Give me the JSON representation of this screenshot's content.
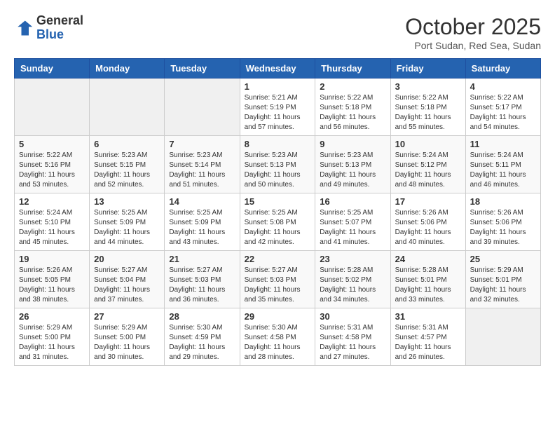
{
  "header": {
    "logo_general": "General",
    "logo_blue": "Blue",
    "month_title": "October 2025",
    "subtitle": "Port Sudan, Red Sea, Sudan"
  },
  "weekdays": [
    "Sunday",
    "Monday",
    "Tuesday",
    "Wednesday",
    "Thursday",
    "Friday",
    "Saturday"
  ],
  "weeks": [
    [
      {
        "day": "",
        "info": ""
      },
      {
        "day": "",
        "info": ""
      },
      {
        "day": "",
        "info": ""
      },
      {
        "day": "1",
        "info": "Sunrise: 5:21 AM\nSunset: 5:19 PM\nDaylight: 11 hours and 57 minutes."
      },
      {
        "day": "2",
        "info": "Sunrise: 5:22 AM\nSunset: 5:18 PM\nDaylight: 11 hours and 56 minutes."
      },
      {
        "day": "3",
        "info": "Sunrise: 5:22 AM\nSunset: 5:18 PM\nDaylight: 11 hours and 55 minutes."
      },
      {
        "day": "4",
        "info": "Sunrise: 5:22 AM\nSunset: 5:17 PM\nDaylight: 11 hours and 54 minutes."
      }
    ],
    [
      {
        "day": "5",
        "info": "Sunrise: 5:22 AM\nSunset: 5:16 PM\nDaylight: 11 hours and 53 minutes."
      },
      {
        "day": "6",
        "info": "Sunrise: 5:23 AM\nSunset: 5:15 PM\nDaylight: 11 hours and 52 minutes."
      },
      {
        "day": "7",
        "info": "Sunrise: 5:23 AM\nSunset: 5:14 PM\nDaylight: 11 hours and 51 minutes."
      },
      {
        "day": "8",
        "info": "Sunrise: 5:23 AM\nSunset: 5:13 PM\nDaylight: 11 hours and 50 minutes."
      },
      {
        "day": "9",
        "info": "Sunrise: 5:23 AM\nSunset: 5:13 PM\nDaylight: 11 hours and 49 minutes."
      },
      {
        "day": "10",
        "info": "Sunrise: 5:24 AM\nSunset: 5:12 PM\nDaylight: 11 hours and 48 minutes."
      },
      {
        "day": "11",
        "info": "Sunrise: 5:24 AM\nSunset: 5:11 PM\nDaylight: 11 hours and 46 minutes."
      }
    ],
    [
      {
        "day": "12",
        "info": "Sunrise: 5:24 AM\nSunset: 5:10 PM\nDaylight: 11 hours and 45 minutes."
      },
      {
        "day": "13",
        "info": "Sunrise: 5:25 AM\nSunset: 5:09 PM\nDaylight: 11 hours and 44 minutes."
      },
      {
        "day": "14",
        "info": "Sunrise: 5:25 AM\nSunset: 5:09 PM\nDaylight: 11 hours and 43 minutes."
      },
      {
        "day": "15",
        "info": "Sunrise: 5:25 AM\nSunset: 5:08 PM\nDaylight: 11 hours and 42 minutes."
      },
      {
        "day": "16",
        "info": "Sunrise: 5:25 AM\nSunset: 5:07 PM\nDaylight: 11 hours and 41 minutes."
      },
      {
        "day": "17",
        "info": "Sunrise: 5:26 AM\nSunset: 5:06 PM\nDaylight: 11 hours and 40 minutes."
      },
      {
        "day": "18",
        "info": "Sunrise: 5:26 AM\nSunset: 5:06 PM\nDaylight: 11 hours and 39 minutes."
      }
    ],
    [
      {
        "day": "19",
        "info": "Sunrise: 5:26 AM\nSunset: 5:05 PM\nDaylight: 11 hours and 38 minutes."
      },
      {
        "day": "20",
        "info": "Sunrise: 5:27 AM\nSunset: 5:04 PM\nDaylight: 11 hours and 37 minutes."
      },
      {
        "day": "21",
        "info": "Sunrise: 5:27 AM\nSunset: 5:03 PM\nDaylight: 11 hours and 36 minutes."
      },
      {
        "day": "22",
        "info": "Sunrise: 5:27 AM\nSunset: 5:03 PM\nDaylight: 11 hours and 35 minutes."
      },
      {
        "day": "23",
        "info": "Sunrise: 5:28 AM\nSunset: 5:02 PM\nDaylight: 11 hours and 34 minutes."
      },
      {
        "day": "24",
        "info": "Sunrise: 5:28 AM\nSunset: 5:01 PM\nDaylight: 11 hours and 33 minutes."
      },
      {
        "day": "25",
        "info": "Sunrise: 5:29 AM\nSunset: 5:01 PM\nDaylight: 11 hours and 32 minutes."
      }
    ],
    [
      {
        "day": "26",
        "info": "Sunrise: 5:29 AM\nSunset: 5:00 PM\nDaylight: 11 hours and 31 minutes."
      },
      {
        "day": "27",
        "info": "Sunrise: 5:29 AM\nSunset: 5:00 PM\nDaylight: 11 hours and 30 minutes."
      },
      {
        "day": "28",
        "info": "Sunrise: 5:30 AM\nSunset: 4:59 PM\nDaylight: 11 hours and 29 minutes."
      },
      {
        "day": "29",
        "info": "Sunrise: 5:30 AM\nSunset: 4:58 PM\nDaylight: 11 hours and 28 minutes."
      },
      {
        "day": "30",
        "info": "Sunrise: 5:31 AM\nSunset: 4:58 PM\nDaylight: 11 hours and 27 minutes."
      },
      {
        "day": "31",
        "info": "Sunrise: 5:31 AM\nSunset: 4:57 PM\nDaylight: 11 hours and 26 minutes."
      },
      {
        "day": "",
        "info": ""
      }
    ]
  ]
}
